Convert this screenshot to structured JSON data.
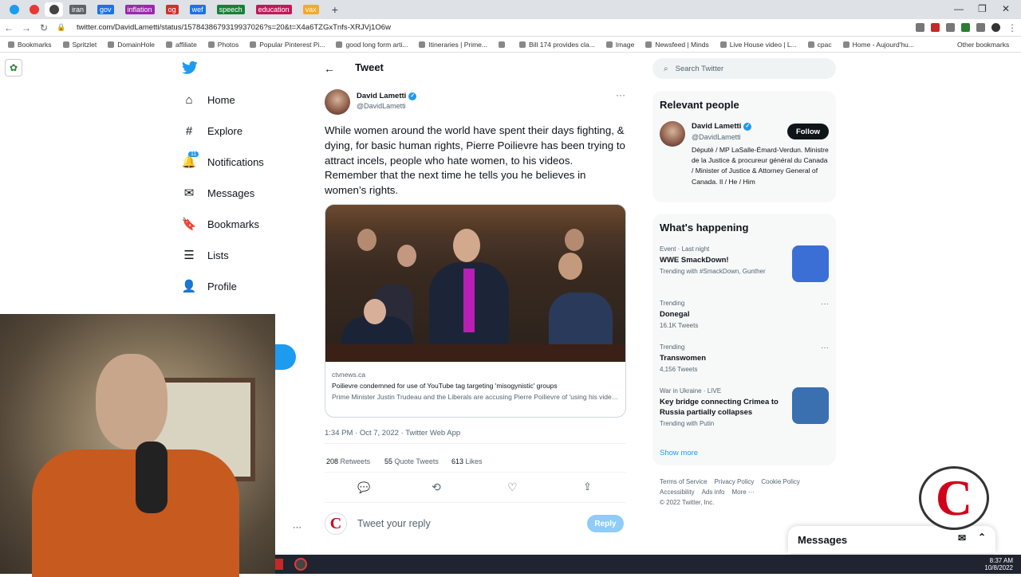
{
  "browser": {
    "tabs": [
      {
        "label": "",
        "color": "#1d9bf0"
      },
      {
        "label": "",
        "color": "#e53935"
      },
      {
        "label": "",
        "color": "#444444"
      },
      {
        "label": "iran",
        "color": "#5f6368"
      },
      {
        "label": "gov",
        "color": "#1a73e8"
      },
      {
        "label": "inflation",
        "color": "#9c27b0"
      },
      {
        "label": "og",
        "color": "#d32f2f"
      },
      {
        "label": "wef",
        "color": "#1a73e8"
      },
      {
        "label": "speech",
        "color": "#188038"
      },
      {
        "label": "education",
        "color": "#c2185b"
      },
      {
        "label": "vax",
        "color": "#f9a825"
      }
    ],
    "url": "twitter.com/DavidLametti/status/1578438679319937026?s=20&t=X4a6TZGxTnfs-XRJVj1O6w",
    "bookmarks": [
      "Bookmarks",
      "Spritzlet",
      "DomainHole",
      "affiliate",
      "Photos",
      "Popular Pinterest Pi...",
      "good long form arti...",
      "Itineraries | Prime...",
      "",
      "Bill 174 provides cla...",
      "Image",
      "Newsfeed | Minds",
      "Live House video | L...",
      "cpac",
      "Home - Aujourd'hu..."
    ],
    "other_bookmarks": "Other bookmarks"
  },
  "nav": {
    "items": [
      {
        "label": "Home",
        "icon": "home-icon",
        "glyph": "⌂"
      },
      {
        "label": "Explore",
        "icon": "hashtag-icon",
        "glyph": "#"
      },
      {
        "label": "Notifications",
        "icon": "bell-icon",
        "glyph": "🔔",
        "badge": "11"
      },
      {
        "label": "Messages",
        "icon": "mail-icon",
        "glyph": "✉"
      },
      {
        "label": "Bookmarks",
        "icon": "bookmark-icon",
        "glyph": "🔖"
      },
      {
        "label": "Lists",
        "icon": "list-icon",
        "glyph": "☰"
      },
      {
        "label": "Profile",
        "icon": "profile-icon",
        "glyph": "👤"
      }
    ],
    "more_dots": "···"
  },
  "tweet": {
    "header": "Tweet",
    "author_name": "David Lametti",
    "author_handle": "@DavidLametti",
    "text": "While women around the world have spent their days fighting, & dying, for basic human rights, Pierre Poilievre has been trying to attract incels, people who hate women, to his videos. Remember that the next time he tells you he believes in women’s rights.",
    "card": {
      "domain": "ctvnews.ca",
      "title": "Poilievre condemned for use of YouTube tag targeting 'misogynistic' groups",
      "desc": "Prime Minister Justin Trudeau and the Liberals are accusing Pierre Poilievre of 'using his videos to appeal to far-right misogynistic online movements,' followin..."
    },
    "timestamp": "1:34 PM · Oct 7, 2022 · Twitter Web App",
    "stats": {
      "retweets_count": "208",
      "retweets_label": "Retweets",
      "quotes_count": "55",
      "quotes_label": "Quote Tweets",
      "likes_count": "613",
      "likes_label": "Likes"
    },
    "reply_placeholder": "Tweet your reply",
    "reply_button": "Reply"
  },
  "sidebar": {
    "search_placeholder": "Search Twitter",
    "relevant_title": "Relevant people",
    "person": {
      "name": "David Lametti",
      "handle": "@DavidLametti",
      "bio": "Député / MP LaSalle-Émard-Verdun. Ministre de la Justice & procureur général du Canada / Minister of Justice & Attorney General of Canada. Il / He / Him",
      "follow_label": "Follow"
    },
    "happening_title": "What's happening",
    "trends": [
      {
        "context": "Event · Last night",
        "title": "WWE SmackDown!",
        "extra": "Trending with #SmackDown, Gunther",
        "has_image": true,
        "img_color": "#3b6fd6"
      },
      {
        "context": "Trending",
        "title": "Donegal",
        "extra": "16.1K Tweets",
        "has_image": false
      },
      {
        "context": "Trending",
        "title": "Transwomen",
        "extra": "4,156 Tweets",
        "has_image": false
      },
      {
        "context": "War in Ukraine · LIVE",
        "title": "Key bridge connecting Crimea to Russia partially collapses",
        "extra": "Trending with Putin",
        "has_image": true,
        "img_color": "#3a6fb0"
      }
    ],
    "show_more": "Show more",
    "footer": [
      "Terms of Service",
      "Privacy Policy",
      "Cookie Policy",
      "Accessibility",
      "Ads info",
      "More ···",
      "© 2022 Twitter, Inc."
    ]
  },
  "messages_dock": "Messages",
  "taskbar": {
    "time": "8:37 AM",
    "date": "10/8/2022"
  },
  "logo_letter": "C",
  "colors": {
    "twitter_blue": "#1d9bf0",
    "text_gray": "#536471",
    "border": "#cfd9de"
  }
}
